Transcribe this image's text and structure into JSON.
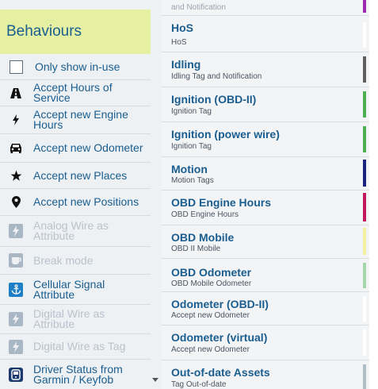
{
  "left_panel": {
    "title": "Behaviours",
    "items": [
      {
        "label": "Only show in-use",
        "icon": "checkbox-icon",
        "dim": false
      },
      {
        "label": "Accept Hours of Service",
        "icon": "hos-road-icon",
        "dim": false
      },
      {
        "label": "Accept new Engine Hours",
        "icon": "lightning-icon",
        "dim": false
      },
      {
        "label": "Accept new Odometer",
        "icon": "car-icon",
        "dim": false
      },
      {
        "label": "Accept new Places",
        "icon": "star-icon",
        "dim": false
      },
      {
        "label": "Accept new Positions",
        "icon": "map-pin-icon",
        "dim": false
      },
      {
        "label": "Analog Wire as Attribute",
        "icon": "lightning-icon",
        "dim": true
      },
      {
        "label": "Break mode",
        "icon": "coffee-icon",
        "dim": true
      },
      {
        "label": "Cellular Signal Attribute",
        "icon": "anchor-icon",
        "dim": false
      },
      {
        "label": "Digital Wire as Attribute",
        "icon": "lightning-icon",
        "dim": true
      },
      {
        "label": "Digital Wire as Tag",
        "icon": "lightning-icon",
        "dim": true
      },
      {
        "label": "Driver Status from Garmin / Keyfob",
        "icon": "device-icon",
        "dim": false
      }
    ]
  },
  "right_list": {
    "top_partial_subtitle": "and Notification",
    "top_partial_color": "#9c27b0",
    "items": [
      {
        "title": "HoS",
        "subtitle": "HoS",
        "color": "#ffffff"
      },
      {
        "title": "Idling",
        "subtitle": "Idling Tag and Notification",
        "color": "#5f5f5f"
      },
      {
        "title": "Ignition (OBD-II)",
        "subtitle": "Ignition Tag",
        "color": "#4caf50"
      },
      {
        "title": "Ignition (power wire)",
        "subtitle": "Ignition Tag",
        "color": "#4caf50"
      },
      {
        "title": "Motion",
        "subtitle": "Motion Tags",
        "color": "#1a237e"
      },
      {
        "title": "OBD Engine Hours",
        "subtitle": "OBD Engine Hours",
        "color": "#c2185b"
      },
      {
        "title": "OBD Mobile",
        "subtitle": "OBD II Mobile",
        "color": "#f5f0a0"
      },
      {
        "title": "OBD Odometer",
        "subtitle": "OBD Mobile Odometer",
        "color": "#a5d6a7"
      },
      {
        "title": "Odometer (OBD-II)",
        "subtitle": "Accept new Odometer",
        "color": "#ffffff"
      },
      {
        "title": "Odometer (virtual)",
        "subtitle": "Accept new Odometer",
        "color": "#ffffff"
      },
      {
        "title": "Out-of-date Assets",
        "subtitle": "Tag Out-of-date",
        "color": "#b0bec5"
      }
    ]
  }
}
